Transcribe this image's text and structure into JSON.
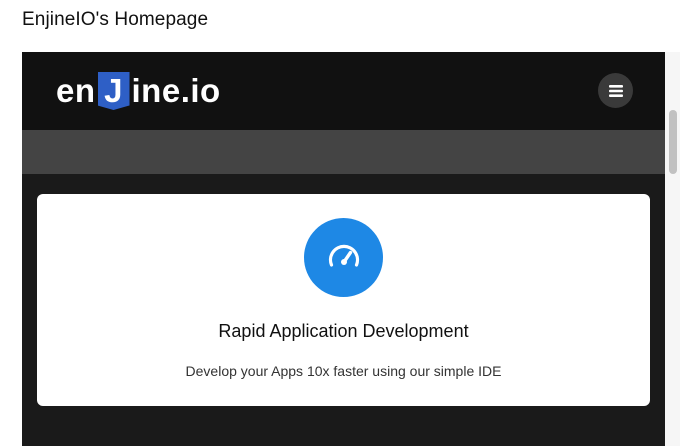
{
  "page": {
    "title": "EnjineIO's Homepage"
  },
  "navbar": {
    "logo_prefix": "en",
    "logo_j": "J",
    "logo_suffix": "ine.io",
    "menu_icon": "hamburger-menu-icon"
  },
  "feature_card": {
    "icon": "speedometer-icon",
    "title": "Rapid Application Development",
    "text": "Develop your Apps 10x faster using our simple IDE"
  },
  "colors": {
    "navbar_bg": "#111111",
    "banner_bg": "#444444",
    "content_bg": "#1a1a1a",
    "logo_j_bg": "#2e5fc6",
    "feature_icon_bg": "#1e88e5"
  }
}
